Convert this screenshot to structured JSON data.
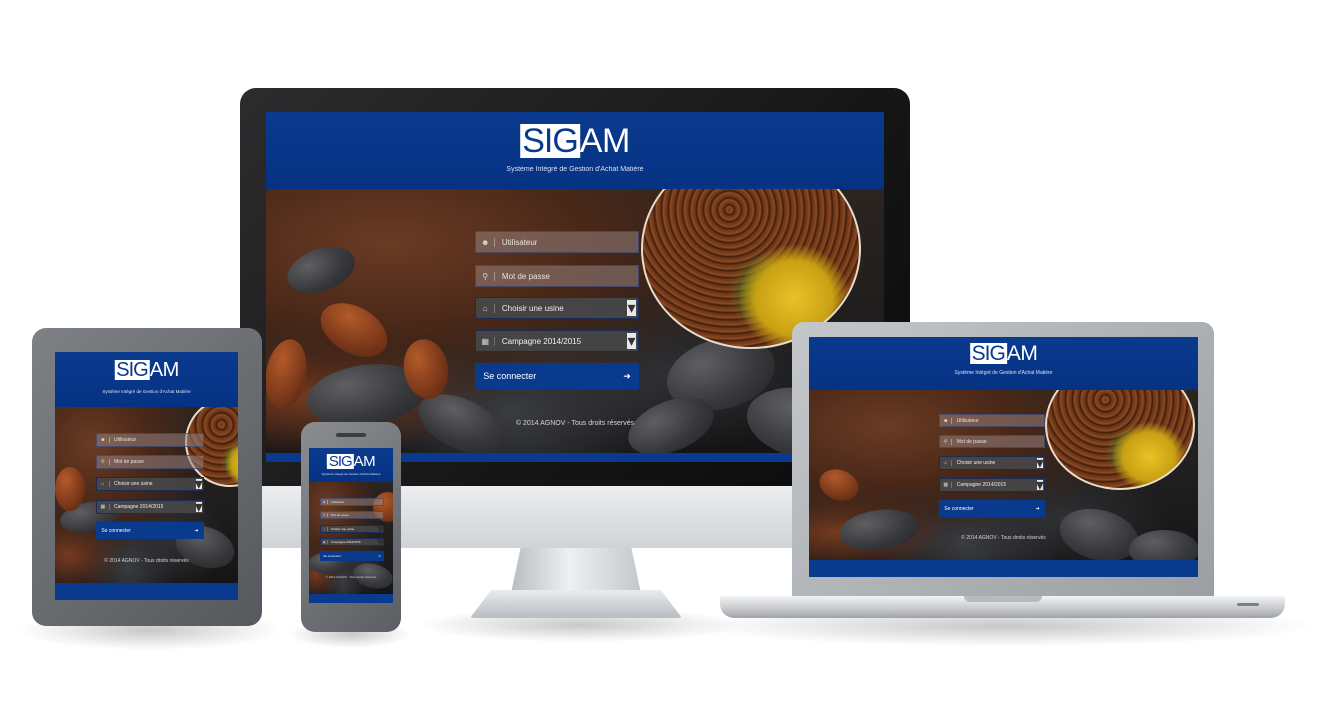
{
  "app": {
    "logo_boxed": "SIG",
    "logo_rest": "AM",
    "tagline": "Système Intégré de Gestion d'Achat Matière",
    "username_placeholder": "Utilisateur",
    "password_placeholder": "Mot de passe",
    "factory_select": "Choisir une usine",
    "campaign_select": "Campagne 2014/2015",
    "login_button": "Se connecter",
    "copyright": "© 2014 AGNOV - Tous droits réservés"
  },
  "icons": {
    "user": "user-icon",
    "key": "key-icon",
    "home": "home-icon",
    "calendar": "calendar-icon",
    "chevron": "chevron-down-icon",
    "login": "sign-in-icon"
  },
  "colors": {
    "brand_blue": "#0a3a8e",
    "field_bg": "#96827d",
    "select_bg": "#464648"
  }
}
